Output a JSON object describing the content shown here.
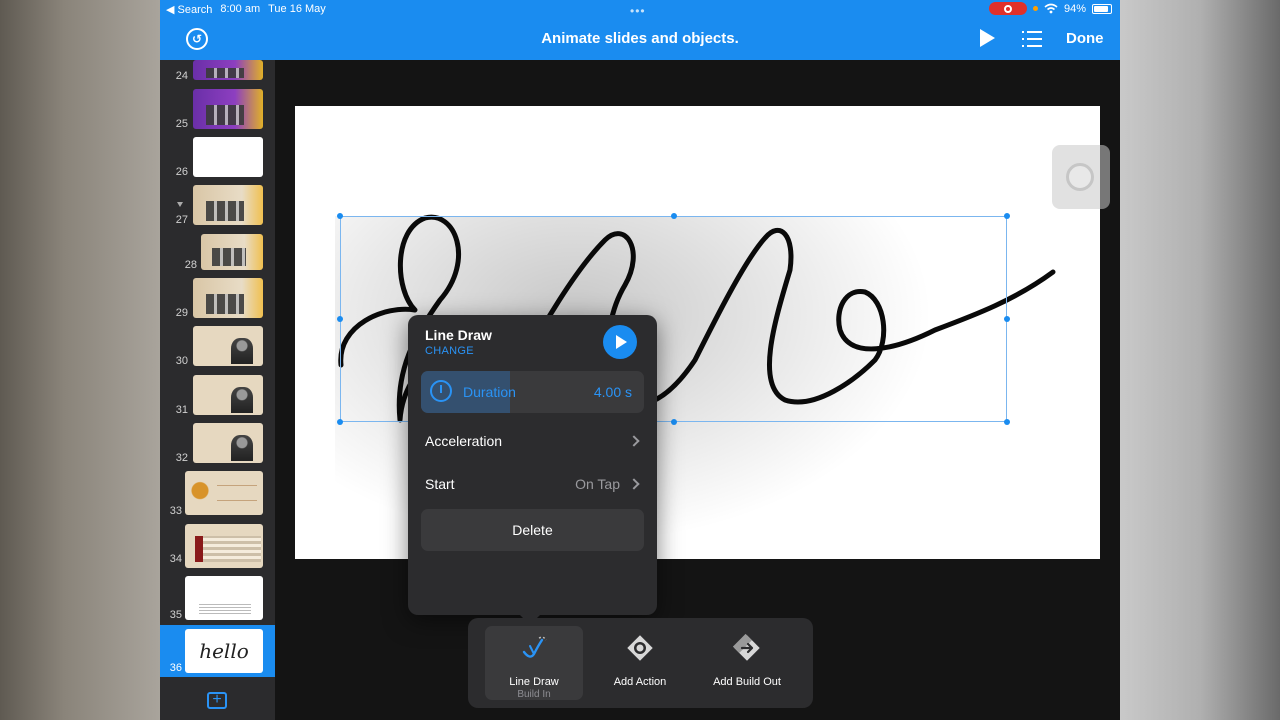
{
  "status": {
    "back_app": "◀ Search",
    "time": "8:00 am",
    "date": "Tue 16 May",
    "battery": "94%"
  },
  "toolbar": {
    "title": "Animate slides and objects.",
    "done_label": "Done"
  },
  "navigator": {
    "slides": [
      {
        "number": "24"
      },
      {
        "number": "25"
      },
      {
        "number": "26"
      },
      {
        "number": "27"
      },
      {
        "number": "28"
      },
      {
        "number": "29"
      },
      {
        "number": "30"
      },
      {
        "number": "31"
      },
      {
        "number": "32"
      },
      {
        "number": "33"
      },
      {
        "number": "34"
      },
      {
        "number": "35"
      },
      {
        "number": "36"
      }
    ],
    "selected_slide": "36",
    "thumb_36_text": "hello"
  },
  "canvas": {
    "slide_text": "hello"
  },
  "popover": {
    "title": "Line Draw",
    "change_label": "CHANGE",
    "duration_label": "Duration",
    "duration_value": "4.00 s",
    "duration_fill_percent": 40,
    "acceleration_label": "Acceleration",
    "start_label": "Start",
    "start_value": "On Tap",
    "delete_label": "Delete"
  },
  "tray": {
    "items": [
      {
        "label": "Line Draw",
        "sublabel": "Build In",
        "icon": "line-draw-icon"
      },
      {
        "label": "Add Action",
        "icon": "action-diamond-icon"
      },
      {
        "label": "Add Build Out",
        "icon": "build-out-icon"
      }
    ]
  },
  "colors": {
    "accent": "#1a8cf0",
    "recording": "#e0302a",
    "panel": "#2c2c2e"
  }
}
